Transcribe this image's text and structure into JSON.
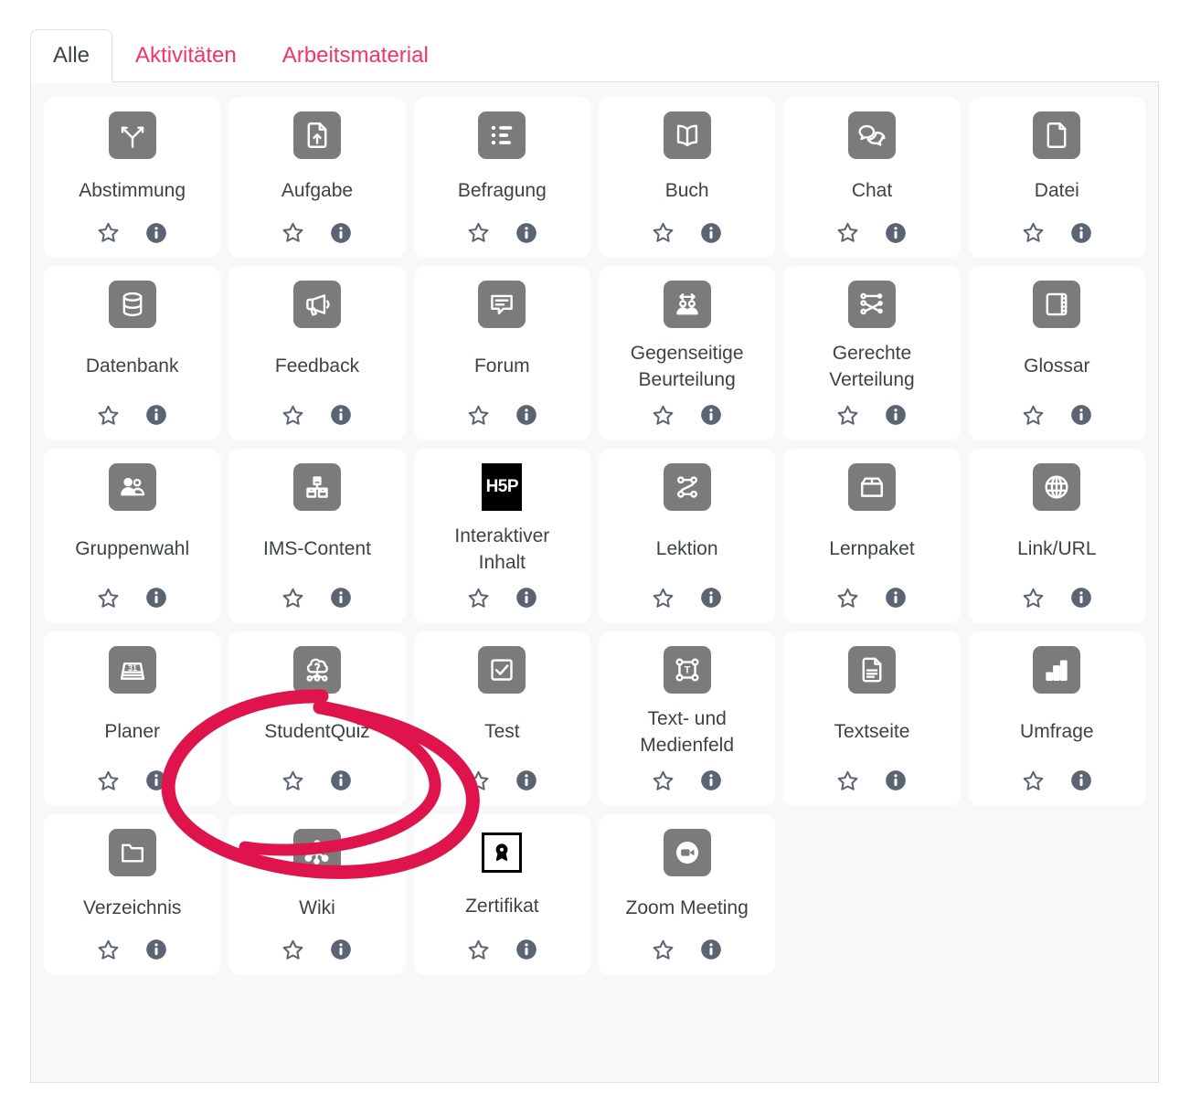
{
  "tabs": [
    {
      "label": "Alle",
      "active": true
    },
    {
      "label": "Aktivitäten",
      "active": false
    },
    {
      "label": "Arbeitsmaterial",
      "active": false
    }
  ],
  "colors": {
    "tab_inactive": "#f8326b",
    "tab_active_text": "#3c4348",
    "icon_bg": "#7b7b7b",
    "panel_bg": "#f7f8fa",
    "card_bg": "#ffffff",
    "annotation": "#e0144c"
  },
  "annotation": {
    "shape": "hand-drawn-ellipse",
    "target": "StudentQuiz",
    "color": "#e0144c"
  },
  "actions": {
    "star_label": "Favorit",
    "info_label": "Info",
    "star_icon": "star-outline-icon",
    "info_icon": "info-circle-icon"
  },
  "activities": [
    {
      "label": "Abstimmung",
      "icon": "fork-road-icon"
    },
    {
      "label": "Aufgabe",
      "icon": "file-upload-icon"
    },
    {
      "label": "Befragung",
      "icon": "survey-list-icon"
    },
    {
      "label": "Buch",
      "icon": "book-open-icon"
    },
    {
      "label": "Chat",
      "icon": "chat-bubbles-icon"
    },
    {
      "label": "Datei",
      "icon": "file-page-icon"
    },
    {
      "label": "Datenbank",
      "icon": "database-icon"
    },
    {
      "label": "Feedback",
      "icon": "megaphone-icon"
    },
    {
      "label": "Forum",
      "icon": "forum-bubble-icon"
    },
    {
      "label": "Gegenseitige\nBeurteilung",
      "icon": "peer-assessment-icon"
    },
    {
      "label": "Gerechte\nVerteilung",
      "icon": "fair-allocation-icon"
    },
    {
      "label": "Glossar",
      "icon": "glossary-book-icon"
    },
    {
      "label": "Gruppenwahl",
      "icon": "group-choice-icon"
    },
    {
      "label": "IMS-Content",
      "icon": "ims-package-icon"
    },
    {
      "label": "Interaktiver\nInhalt",
      "icon": "h5p-icon"
    },
    {
      "label": "Lektion",
      "icon": "lesson-flow-icon"
    },
    {
      "label": "Lernpaket",
      "icon": "scorm-box-icon"
    },
    {
      "label": "Link/URL",
      "icon": "globe-icon"
    },
    {
      "label": "Planer",
      "icon": "calendar-31-icon"
    },
    {
      "label": "StudentQuiz",
      "icon": "cloud-question-icon"
    },
    {
      "label": "Test",
      "icon": "checkbox-check-icon"
    },
    {
      "label": "Text- und\nMedienfeld",
      "icon": "text-media-icon"
    },
    {
      "label": "Textseite",
      "icon": "page-text-icon"
    },
    {
      "label": "Umfrage",
      "icon": "bar-chart-icon"
    },
    {
      "label": "Verzeichnis",
      "icon": "folder-icon"
    },
    {
      "label": "Wiki",
      "icon": "network-nodes-icon"
    },
    {
      "label": "Zertifikat",
      "icon": "award-rosette-icon"
    },
    {
      "label": "Zoom Meeting",
      "icon": "video-camera-circle-icon"
    }
  ]
}
